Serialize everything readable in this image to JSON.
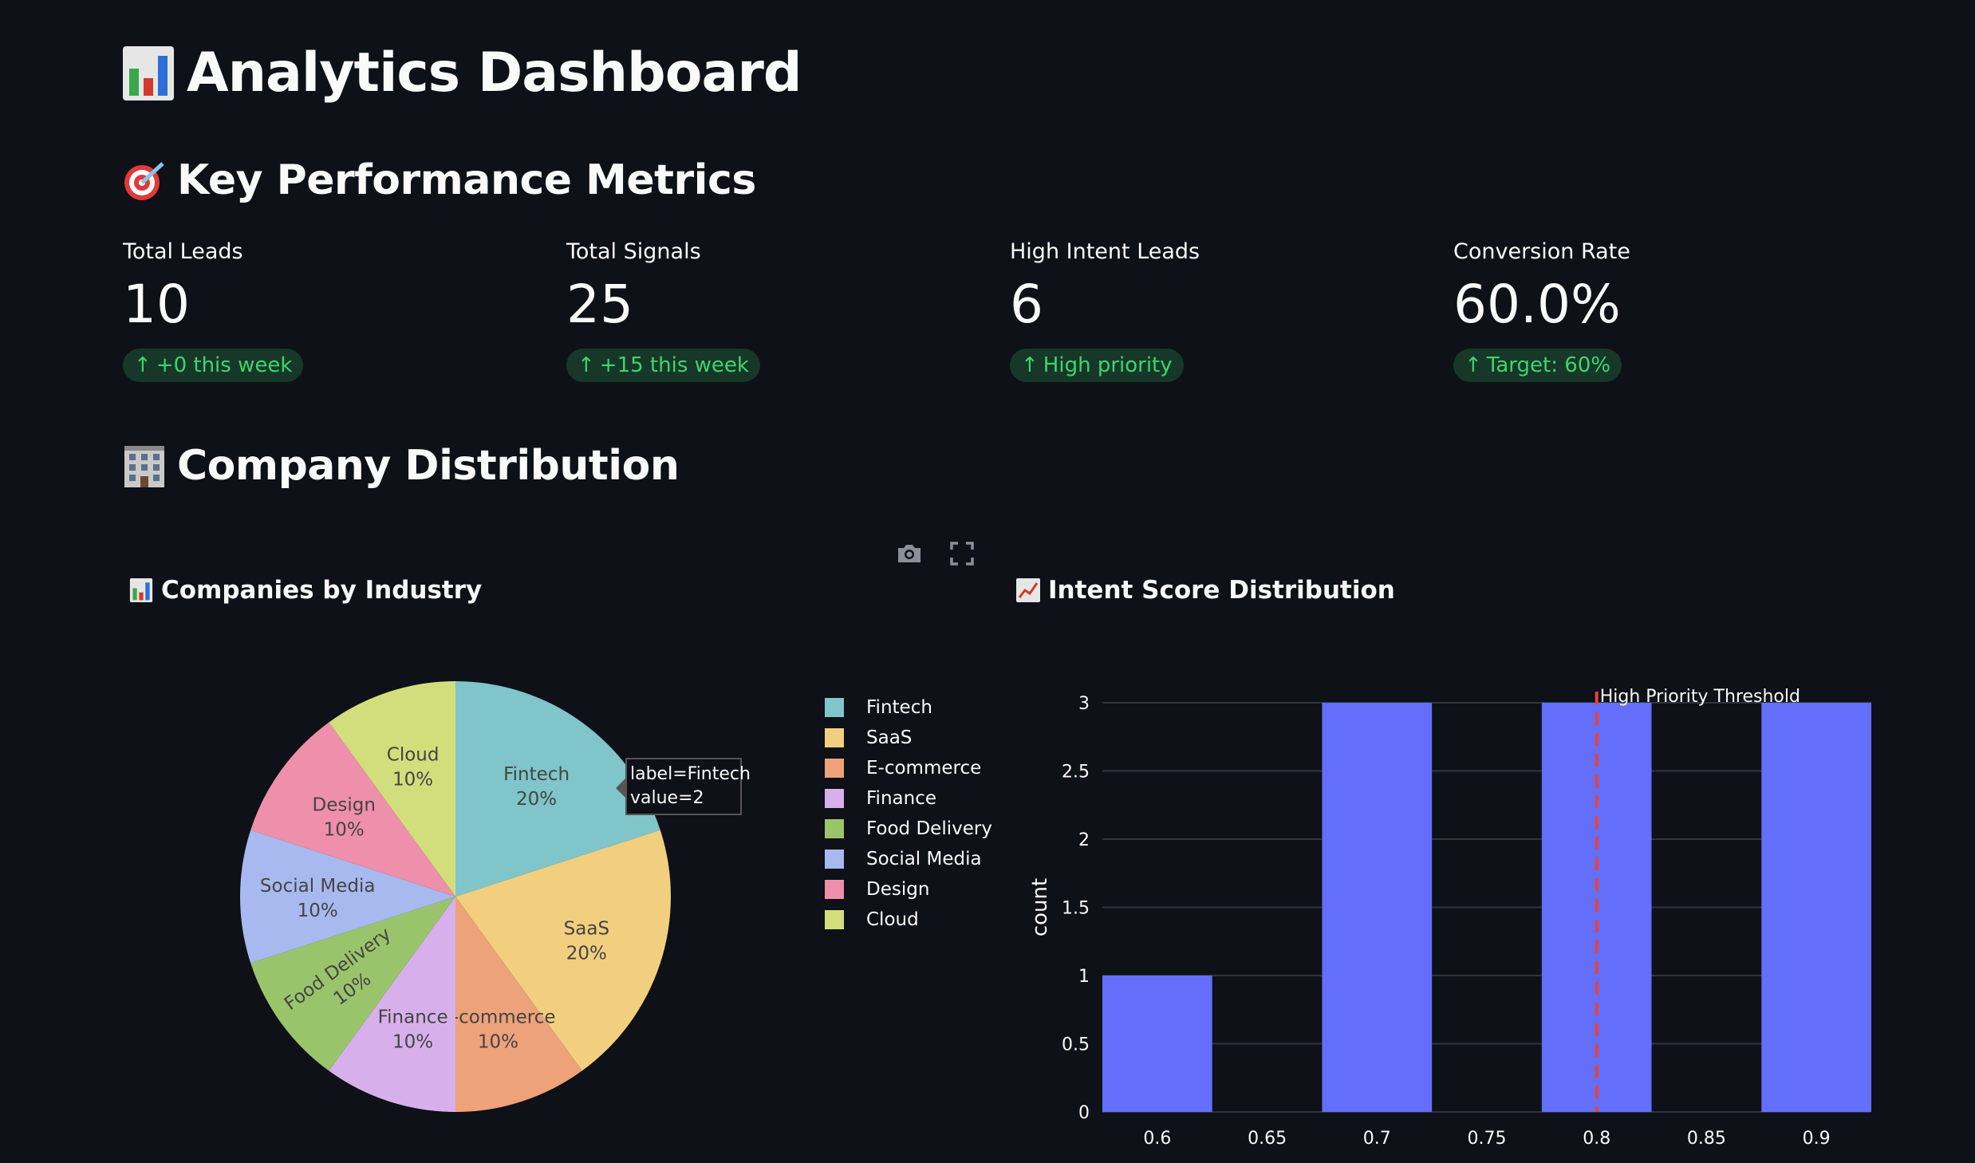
{
  "header": {
    "icon": "bar-chart-icon",
    "title": "Analytics Dashboard"
  },
  "kpi_section": {
    "icon": "target-icon",
    "title": "Key Performance Metrics"
  },
  "metrics": [
    {
      "label": "Total Leads",
      "value": "10",
      "delta": "+0 this week"
    },
    {
      "label": "Total Signals",
      "value": "25",
      "delta": "+15 this week"
    },
    {
      "label": "High Intent Leads",
      "value": "6",
      "delta": "High priority"
    },
    {
      "label": "Conversion Rate",
      "value": "60.0%",
      "delta": "Target: 60%"
    }
  ],
  "delta_color": "#3dd56d",
  "company_section": {
    "icon": "office-building-icon",
    "title": "Company Distribution"
  },
  "toolbar": {
    "camera": "camera-icon",
    "fullscreen": "fullscreen-icon"
  },
  "pie_chart": {
    "title": "Companies by Industry",
    "title_icon": "bar-chart-icon",
    "tooltip": {
      "label_line": "label=Fintech",
      "value_line": "value=2"
    }
  },
  "hist_chart": {
    "title": "Intent Score Distribution",
    "title_icon": "line-chart-icon",
    "threshold_label": "High Priority Threshold",
    "ylabel": "count"
  },
  "chart_data": [
    {
      "type": "pie",
      "title": "Companies by Industry",
      "labels": [
        "Fintech",
        "SaaS",
        "E-commerce",
        "Finance",
        "Food Delivery",
        "Social Media",
        "Design",
        "Cloud"
      ],
      "values": [
        2,
        2,
        1,
        1,
        1,
        1,
        1,
        1
      ],
      "percent_labels": [
        "20%",
        "20%",
        "10%",
        "10%",
        "10%",
        "10%",
        "10%",
        "10%"
      ],
      "colors": [
        "#7fc5c9",
        "#f2cf7f",
        "#eda27a",
        "#d7b0eb",
        "#9ac46b",
        "#a7b9ef",
        "#ee8fab",
        "#d2de7c"
      ],
      "legend": "right"
    },
    {
      "type": "bar",
      "title": "Intent Score Distribution",
      "ylabel": "count",
      "x_ticks": [
        "0.6",
        "0.65",
        "0.7",
        "0.75",
        "0.8",
        "0.85",
        "0.9"
      ],
      "y_ticks": [
        "0",
        "0.5",
        "1",
        "1.5",
        "2",
        "2.5",
        "3"
      ],
      "bins": [
        {
          "center": 0.6,
          "count": 1
        },
        {
          "center": 0.7,
          "count": 3
        },
        {
          "center": 0.8,
          "count": 3
        },
        {
          "center": 0.9,
          "count": 3
        }
      ],
      "ylim": [
        0,
        3
      ],
      "xlim": [
        0.575,
        0.925
      ],
      "threshold": 0.8,
      "bar_color": "#636efa",
      "threshold_color": "#e8413b",
      "grid": true
    }
  ]
}
